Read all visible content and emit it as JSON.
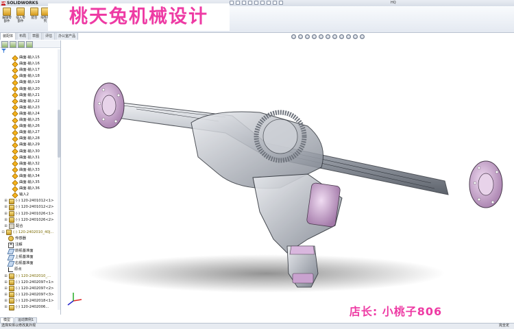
{
  "titlebar": {
    "app_name": "SOLIDWORKS",
    "document_title": "HQ"
  },
  "ribbon": {
    "buttons": [
      {
        "label": "编辑零部件",
        "icon": "edit-component-icon"
      },
      {
        "label": "插入零部件",
        "icon": "insert-component-icon"
      },
      {
        "label": "配合",
        "icon": "mate-icon"
      },
      {
        "label": "线性阵列",
        "icon": "linear-pattern-icon"
      }
    ]
  },
  "watermark_text": "桃天兔机械设计",
  "manager_tabs": [
    "装配体",
    "布局",
    "草图",
    "评估",
    "办公室产品"
  ],
  "tree": {
    "surface_items": [
      "曲面-输入15",
      "曲面-输入16",
      "曲面-输入17",
      "曲面-输入18",
      "曲面-输入19",
      "曲面-输入20",
      "曲面-输入21",
      "曲面-输入22",
      "曲面-输入23",
      "曲面-输入24",
      "曲面-输入25",
      "曲面-输入26",
      "曲面-输入27",
      "曲面-输入28",
      "曲面-输入29",
      "曲面-输入30",
      "曲面-输入31",
      "曲面-输入32",
      "曲面-输入33",
      "曲面-输入34",
      "曲面-输入35",
      "曲面-输入36"
    ],
    "input_item": "输入2",
    "parts": [
      "(-) 120-2401012<1>",
      "(-) 120-2401012<2>",
      "(-) 120-2401026<1>",
      "(-) 120-2401026<2>"
    ],
    "mates": "配合",
    "subassembly": "(-) 120-2402010_40J...",
    "sub_children": [
      "传感器",
      "注解",
      "前视基准面",
      "上视基准面",
      "右视基准面",
      "原点"
    ],
    "parts2": [
      "(-) 120-2402010_...",
      "(-) 120-2402097<1>",
      "(-) 120-2402097<2>",
      "(-) 120-2402097<3>",
      "(-) 120-2402018<1>",
      "(-) 120-2402006..."
    ]
  },
  "bottom_tabs": [
    "模型",
    "运动算例1"
  ],
  "status": {
    "left": "选择实体以修改其外观",
    "right": "完全定"
  },
  "shopkeeper_text": "店长: 小桃子806",
  "colors": {
    "watermark": "#ee3ba4",
    "flange": "#c9a2cf",
    "housing": "#b8bcc4"
  }
}
